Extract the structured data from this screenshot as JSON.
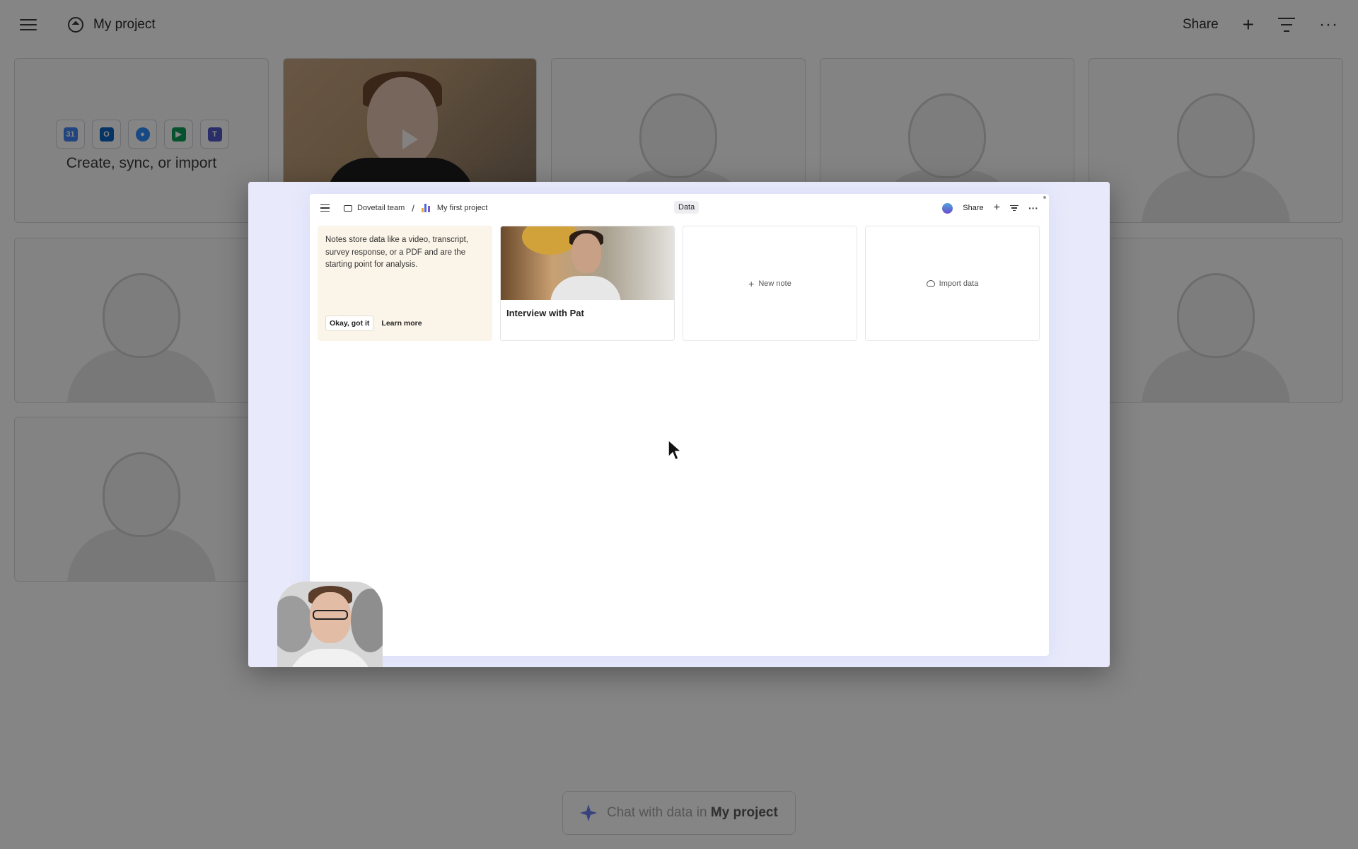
{
  "app": {
    "project_title": "My project",
    "share_label": "Share",
    "plus_symbol": "+",
    "more_symbol": "···",
    "import_card_label": "Create, sync, or import",
    "import_icons": [
      "google-calendar-icon",
      "outlook-icon",
      "zoom-icon",
      "google-meet-icon",
      "teams-icon"
    ]
  },
  "chat": {
    "prefix": "Chat with data in ",
    "project": "My project"
  },
  "modal": {
    "breadcrumb_team": "Dovetail team",
    "breadcrumb_separator": "/",
    "breadcrumb_project": "My first project",
    "active_tab": "Data",
    "share_label": "Share",
    "plus_symbol": "+",
    "more_symbol": "···",
    "tip_text": "Notes store data like a video, transcript, survey response, or a PDF and are the starting point for analysis.",
    "tip_ok": "Okay, got it",
    "tip_learn": "Learn more",
    "interview_title": "Interview with Pat",
    "new_note_icon": "+",
    "new_note_label": "New note",
    "import_label": "Import data"
  },
  "colors": {
    "accent_purple": "#6a7ff5",
    "modal_bg": "#e8eafb",
    "tip_bg": "#fbf4e8"
  }
}
